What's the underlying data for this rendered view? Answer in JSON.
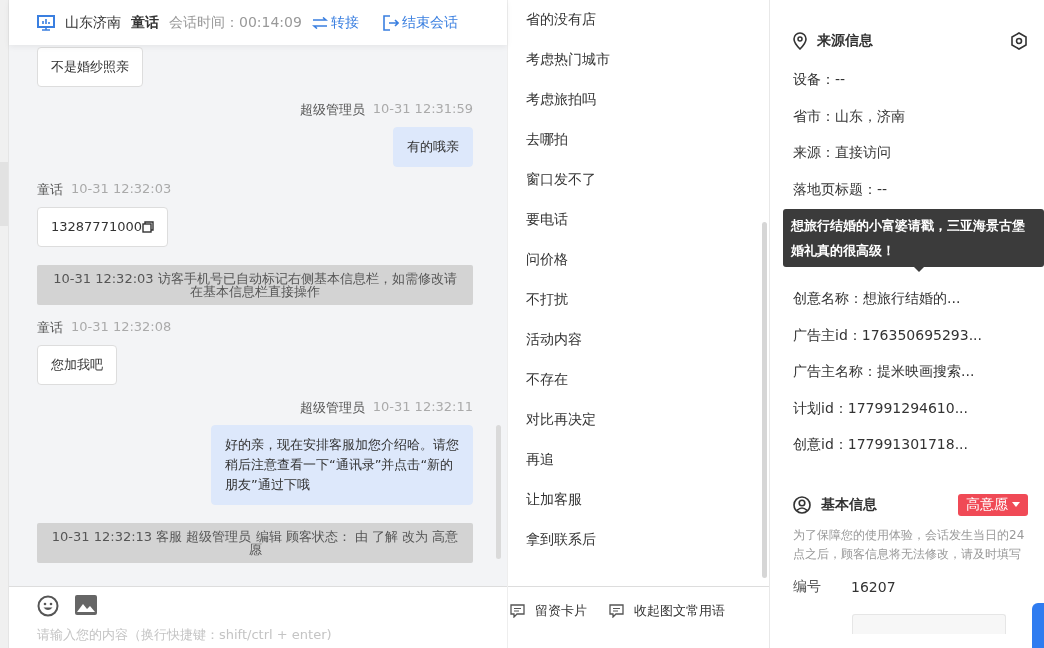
{
  "header": {
    "location": "山东济南",
    "visitor": "童话",
    "timer_label": "会话时间：",
    "timer": "00:14:09",
    "transfer": "转接",
    "end": "结束会话"
  },
  "messages": [
    {
      "kind": "in",
      "text": "不是婚纱照亲"
    },
    {
      "kind": "out",
      "sender": "超级管理员",
      "time": "10-31 12:31:59",
      "text": "有的哦亲"
    },
    {
      "kind": "in",
      "sender": "童话",
      "time": "10-31 12:32:03",
      "text": "13287771000",
      "copyable": true
    },
    {
      "kind": "system",
      "text": "10-31 12:32:03 访客手机号已自动标记右侧基本信息栏，如需修改请在基本信息栏直接操作"
    },
    {
      "kind": "in",
      "sender": "童话",
      "time": "10-31 12:32:08",
      "text": "您加我吧"
    },
    {
      "kind": "out",
      "sender": "超级管理员",
      "time": "10-31 12:32:11",
      "text": "好的亲，现在安排客服加您介绍哈。请您稍后注意查看一下“通讯录”并点击“新的朋友”通过下哦"
    },
    {
      "kind": "system",
      "text": "10-31 12:32:13 客服 超级管理员 编辑 顾客状态： 由 了解 改为 高意愿"
    }
  ],
  "input": {
    "placeholder": "请输入您的内容（换行快捷键：shift/ctrl + enter)"
  },
  "quick_phrases": [
    "省的没有店",
    "考虑热门城市",
    "考虑旅拍吗",
    "去哪拍",
    "窗口发不了",
    "要电话",
    "问价格",
    "不打扰",
    "活动内容",
    "不存在",
    "对比再决定",
    "再追",
    "让加客服",
    "拿到联系后"
  ],
  "phrase_actions": [
    "留资卡片",
    "收起图文常用语"
  ],
  "source_info": {
    "title": "来源信息",
    "rows_before": [
      "设备：--",
      "省市：山东，济南",
      "来源：直接访问",
      "落地页标题：--"
    ],
    "tooltip": "想旅行结婚的小富婆请戳，三亚海景古堡婚礼真的很高级！",
    "rows_after": [
      "创意名称：想旅行结婚的...",
      "广告主id：176350695293...",
      "广告主名称：提米映画搜索...",
      "计划id：177991294610...",
      "创意id：177991301718..."
    ]
  },
  "basic_info": {
    "title": "基本信息",
    "status": "高意愿",
    "notice": "为了保障您的使用体验，会话发生当日的24点之后，顾客信息将无法修改，请及时填写",
    "fields": [
      {
        "label": "编号",
        "value": "16207"
      }
    ]
  }
}
